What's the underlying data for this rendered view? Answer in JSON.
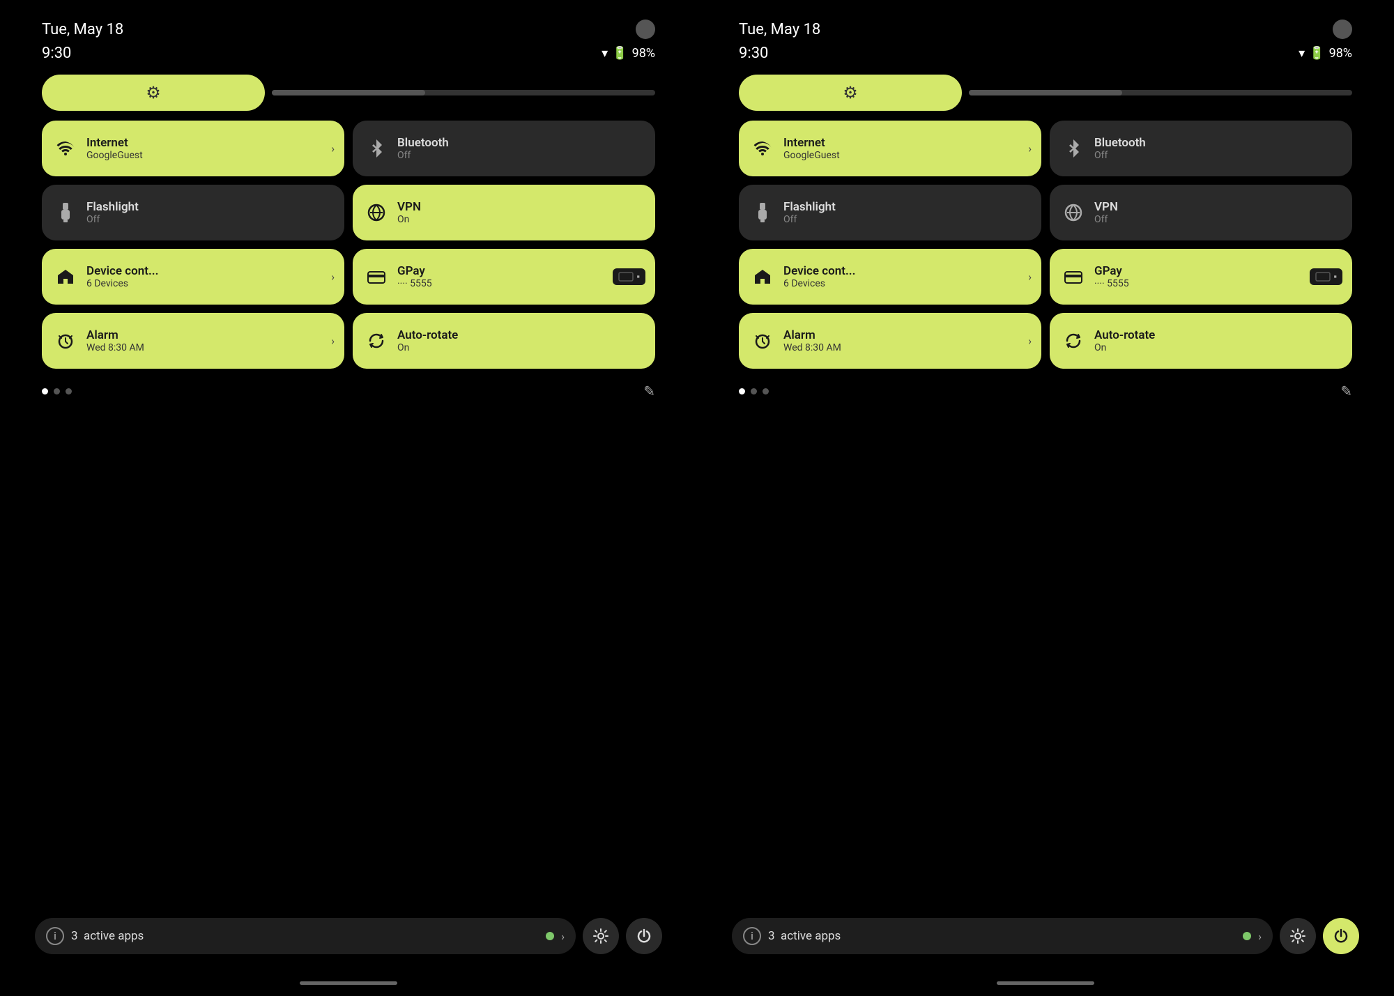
{
  "colors": {
    "active_tile": "#d4e86b",
    "inactive_tile": "#2a2a2a",
    "background": "#000000",
    "active_text": "#1a1a1a",
    "inactive_text": "#dddddd",
    "inactive_sub": "#888888"
  },
  "panel_left": {
    "status": {
      "date": "Tue, May 18",
      "time": "9:30",
      "battery": "98%",
      "dot_color": "#555555"
    },
    "brightness": {
      "aria": "brightness slider"
    },
    "tiles": [
      {
        "id": "internet",
        "title": "Internet",
        "subtitle": "GoogleGuest",
        "active": true,
        "has_chevron": true,
        "icon": "wifi"
      },
      {
        "id": "bluetooth",
        "title": "Bluetooth",
        "subtitle": "Off",
        "active": false,
        "has_chevron": false,
        "icon": "bluetooth"
      },
      {
        "id": "flashlight",
        "title": "Flashlight",
        "subtitle": "Off",
        "active": false,
        "has_chevron": false,
        "icon": "flashlight"
      },
      {
        "id": "vpn",
        "title": "VPN",
        "subtitle": "On",
        "active": true,
        "has_chevron": false,
        "icon": "vpn"
      },
      {
        "id": "device_cont",
        "title": "Device cont...",
        "subtitle": "6 Devices",
        "active": true,
        "has_chevron": true,
        "icon": "home"
      },
      {
        "id": "gpay",
        "title": "GPay",
        "subtitle": "···· 5555",
        "active": true,
        "has_chevron": false,
        "icon": "card",
        "has_badge": true
      },
      {
        "id": "alarm",
        "title": "Alarm",
        "subtitle": "Wed 8:30 AM",
        "active": true,
        "has_chevron": true,
        "icon": "alarm"
      },
      {
        "id": "autorotate",
        "title": "Auto-rotate",
        "subtitle": "On",
        "active": true,
        "has_chevron": false,
        "icon": "rotate"
      }
    ],
    "dots": [
      true,
      false,
      false
    ],
    "bottom": {
      "active_apps_count": "3",
      "active_apps_label": "active apps",
      "gear_label": "Settings",
      "power_label": "Power",
      "power_active": false
    }
  },
  "panel_right": {
    "status": {
      "date": "Tue, May 18",
      "time": "9:30",
      "battery": "98%",
      "dot_color": "#555555"
    },
    "brightness": {
      "aria": "brightness slider"
    },
    "tiles": [
      {
        "id": "internet",
        "title": "Internet",
        "subtitle": "GoogleGuest",
        "active": true,
        "has_chevron": true,
        "icon": "wifi"
      },
      {
        "id": "bluetooth",
        "title": "Bluetooth",
        "subtitle": "Off",
        "active": false,
        "has_chevron": false,
        "icon": "bluetooth"
      },
      {
        "id": "flashlight",
        "title": "Flashlight",
        "subtitle": "Off",
        "active": false,
        "has_chevron": false,
        "icon": "flashlight"
      },
      {
        "id": "vpn",
        "title": "VPN",
        "subtitle": "Off",
        "active": false,
        "has_chevron": false,
        "icon": "vpn"
      },
      {
        "id": "device_cont",
        "title": "Device cont...",
        "subtitle": "6 Devices",
        "active": true,
        "has_chevron": true,
        "icon": "home"
      },
      {
        "id": "gpay",
        "title": "GPay",
        "subtitle": "···· 5555",
        "active": true,
        "has_chevron": false,
        "icon": "card",
        "has_badge": true
      },
      {
        "id": "alarm",
        "title": "Alarm",
        "subtitle": "Wed 8:30 AM",
        "active": true,
        "has_chevron": true,
        "icon": "alarm"
      },
      {
        "id": "autorotate",
        "title": "Auto-rotate",
        "subtitle": "On",
        "active": true,
        "has_chevron": false,
        "icon": "rotate"
      }
    ],
    "dots": [
      true,
      false,
      false
    ],
    "bottom": {
      "active_apps_count": "3",
      "active_apps_label": "active apps",
      "gear_label": "Settings",
      "power_label": "Power",
      "power_active": true
    }
  }
}
